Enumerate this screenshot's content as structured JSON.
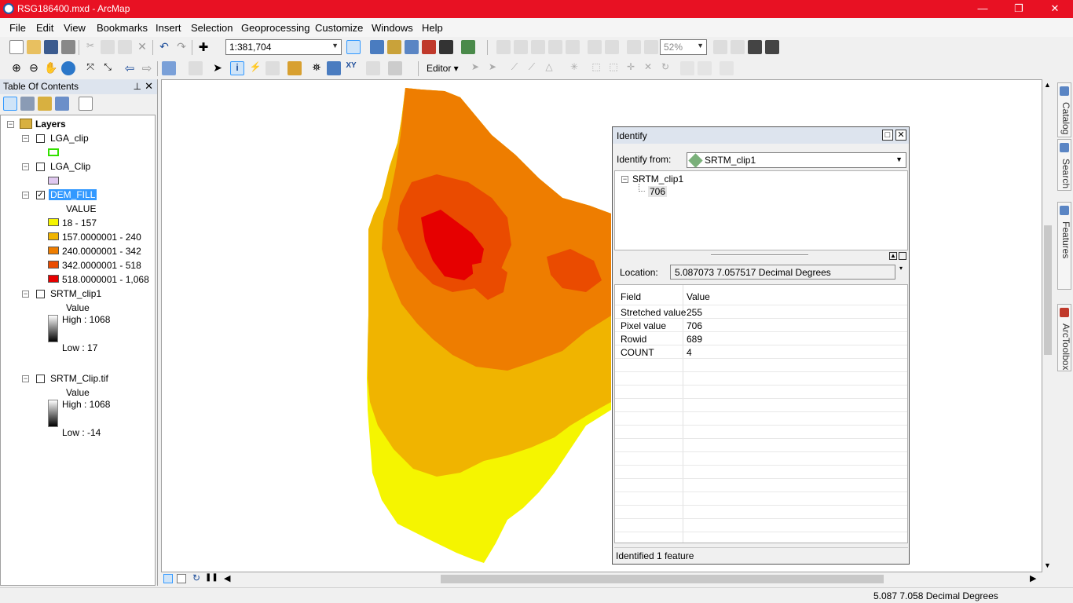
{
  "window": {
    "title": "RSG186400.mxd - ArcMap",
    "minimize": "—",
    "restore": "❐",
    "close": "✕"
  },
  "menu": [
    "File",
    "Edit",
    "View",
    "Bookmarks",
    "Insert",
    "Selection",
    "Geoprocessing",
    "Customize",
    "Windows",
    "Help"
  ],
  "toolbar": {
    "scale": "1:381,704",
    "zoom_pct": "52%",
    "editor_label": "Editor ▾"
  },
  "toc": {
    "title": "Table Of Contents",
    "root": "Layers",
    "layers": [
      {
        "name": "LGA_clip",
        "checked": false
      },
      {
        "name": "LGA_Clip",
        "checked": false
      },
      {
        "name": "DEM_FILL",
        "checked": true,
        "field": "VALUE",
        "classes": [
          {
            "label": "18 - 157",
            "color": "#f5f500"
          },
          {
            "label": "157.0000001 - 240",
            "color": "#f0b400"
          },
          {
            "label": "240.0000001 - 342",
            "color": "#ee7d00"
          },
          {
            "label": "342.0000001 - 518",
            "color": "#ea4b00"
          },
          {
            "label": "518.0000001 - 1,068",
            "color": "#e60000"
          }
        ]
      },
      {
        "name": "SRTM_clip1",
        "checked": false,
        "field": "Value",
        "high": "High : 1068",
        "low": "Low : 17"
      },
      {
        "name": "SRTM_Clip.tif",
        "checked": false,
        "field": "Value",
        "high": "High : 1068",
        "low": "Low : -14"
      }
    ]
  },
  "identify": {
    "title": "Identify",
    "from_label": "Identify from:",
    "from_value": "SRTM_clip1",
    "tree_layer": "SRTM_clip1",
    "tree_value": "706",
    "location_label": "Location:",
    "location_value": "5.087073  7.057517 Decimal Degrees",
    "col_field": "Field",
    "col_value": "Value",
    "rows": [
      {
        "field": "Stretched value",
        "value": "255"
      },
      {
        "field": "Pixel value",
        "value": "706"
      },
      {
        "field": "Rowid",
        "value": "689"
      },
      {
        "field": "COUNT",
        "value": "4"
      }
    ],
    "status": "Identified 1 feature"
  },
  "dock_tabs": [
    "Catalog",
    "Search",
    "Create Features",
    "ArcToolbox"
  ],
  "status": {
    "coords": "5.087  7.058 Decimal Degrees"
  },
  "colors": {
    "title_bar": "#e81123",
    "selection": "#3399ff"
  }
}
